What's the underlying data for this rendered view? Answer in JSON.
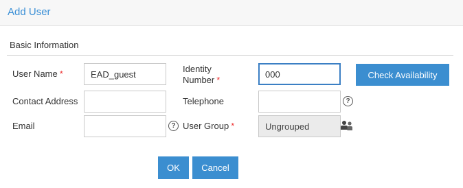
{
  "dialog": {
    "title": "Add User"
  },
  "section": {
    "title": "Basic Information"
  },
  "form": {
    "user_name": {
      "label": "User Name",
      "value": "EAD_guest"
    },
    "identity_number": {
      "label_line1": "Identity",
      "label_line2": "Number",
      "value": "000"
    },
    "check_availability_label": "Check Availability",
    "contact_address": {
      "label": "Contact Address",
      "value": ""
    },
    "telephone": {
      "label": "Telephone",
      "value": ""
    },
    "email": {
      "label": "Email",
      "value": ""
    },
    "user_group": {
      "label": "User Group",
      "value": "Ungrouped"
    },
    "required_marker": "*",
    "help_glyph": "?"
  },
  "actions": {
    "ok_label": "OK",
    "cancel_label": "Cancel"
  },
  "colors": {
    "accent": "#3b8ed0",
    "title": "#3a8fd6",
    "required": "#e33333"
  },
  "icons": {
    "help": "question-circle-icon",
    "user_group_picker": "users-icon"
  }
}
